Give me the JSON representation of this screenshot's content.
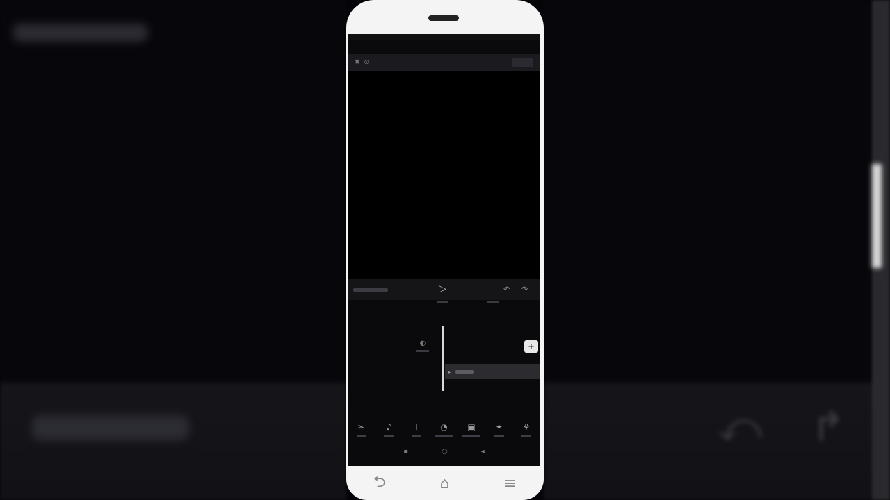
{
  "background": {
    "glyphs": [
      "⤺",
      "↱"
    ]
  },
  "phone": {
    "nav_buttons": [
      {
        "icon": "back-icon",
        "glyph": "⮌"
      },
      {
        "icon": "home-icon",
        "glyph": "⌂"
      },
      {
        "icon": "menu-icon",
        "glyph": "≡"
      }
    ]
  },
  "editor": {
    "topbar": {
      "icons": [
        "close-icon",
        "resolution-icon"
      ],
      "glyphs": [
        "✖",
        "⊙"
      ]
    },
    "controls": {
      "play_glyph": "▷",
      "undo_glyph": "↶",
      "redo_glyph": "↷"
    },
    "timeline": {
      "track_toggle_glyph": "◐",
      "add_glyph": "+",
      "clip_glyph": "▸"
    },
    "toolbar": [
      {
        "name": "tool-edit",
        "glyph": "✂"
      },
      {
        "name": "tool-audio",
        "glyph": "♪"
      },
      {
        "name": "tool-text",
        "glyph": "T"
      },
      {
        "name": "tool-sticker",
        "glyph": "◔"
      },
      {
        "name": "tool-overlay",
        "glyph": "▣"
      },
      {
        "name": "tool-effects",
        "glyph": "✦"
      },
      {
        "name": "tool-filters",
        "glyph": "⚘"
      }
    ],
    "sysnav": [
      "▪",
      "○",
      "◂"
    ]
  }
}
